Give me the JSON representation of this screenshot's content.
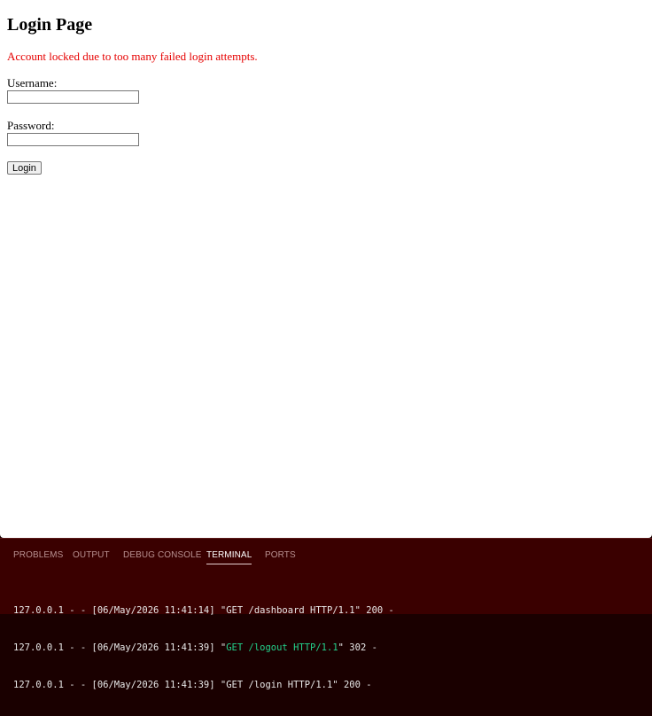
{
  "page": {
    "title": "Login Page",
    "error_message": "Account locked due to too many failed login attempts.",
    "username_label": "Username:",
    "username_value": "",
    "password_label": "Password:",
    "password_value": "",
    "login_button": "Login"
  },
  "panel": {
    "tabs": [
      {
        "label": "PROBLEMS",
        "active": false
      },
      {
        "label": "OUTPUT",
        "active": false
      },
      {
        "label": "DEBUG CONSOLE",
        "active": false
      },
      {
        "label": "TERMINAL",
        "active": true
      },
      {
        "label": "PORTS",
        "active": false
      }
    ],
    "terminal_lines": [
      {
        "prefix": "127.0.0.1 - - [06/May/2026 11:41:14] \"",
        "request": "GET /dashboard HTTP/1.1",
        "suffix": "\" 200 -",
        "highlight": false
      },
      {
        "prefix": "127.0.0.1 - - [06/May/2026 11:41:39] \"",
        "request": "GET /logout HTTP/1.1",
        "suffix": "\" 302 -",
        "highlight": true
      },
      {
        "prefix": "127.0.0.1 - - [06/May/2026 11:41:39] \"",
        "request": "GET /login HTTP/1.1",
        "suffix": "\" 200 -",
        "highlight": false
      }
    ]
  },
  "colors": {
    "error": "#e60000",
    "panel_background": "#3a0000",
    "terminal_highlight": "#23d18b"
  }
}
